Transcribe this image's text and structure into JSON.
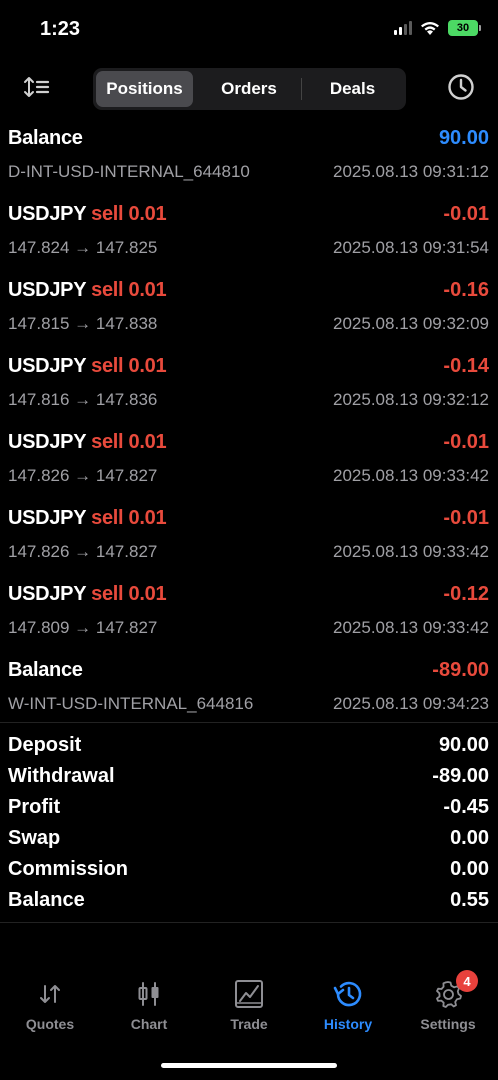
{
  "status": {
    "time": "1:23",
    "battery": "30"
  },
  "tabs": {
    "positions": "Positions",
    "orders": "Orders",
    "deals": "Deals"
  },
  "rows": [
    {
      "title": "Balance",
      "side": "",
      "amount": "90.00",
      "amount_type": "pos",
      "sub": "D-INT-USD-INTERNAL_644810",
      "time": "2025.08.13 09:31:12"
    },
    {
      "title": "USDJPY",
      "side": "sell 0.01",
      "amount": "-0.01",
      "amount_type": "neg",
      "sub": "147.824 → 147.825",
      "time": "2025.08.13 09:31:54"
    },
    {
      "title": "USDJPY",
      "side": "sell 0.01",
      "amount": "-0.16",
      "amount_type": "neg",
      "sub": "147.815 → 147.838",
      "time": "2025.08.13 09:32:09"
    },
    {
      "title": "USDJPY",
      "side": "sell 0.01",
      "amount": "-0.14",
      "amount_type": "neg",
      "sub": "147.816 → 147.836",
      "time": "2025.08.13 09:32:12"
    },
    {
      "title": "USDJPY",
      "side": "sell 0.01",
      "amount": "-0.01",
      "amount_type": "neg",
      "sub": "147.826 → 147.827",
      "time": "2025.08.13 09:33:42"
    },
    {
      "title": "USDJPY",
      "side": "sell 0.01",
      "amount": "-0.01",
      "amount_type": "neg",
      "sub": "147.826 → 147.827",
      "time": "2025.08.13 09:33:42"
    },
    {
      "title": "USDJPY",
      "side": "sell 0.01",
      "amount": "-0.12",
      "amount_type": "neg",
      "sub": "147.809 → 147.827",
      "time": "2025.08.13 09:33:42"
    },
    {
      "title": "Balance",
      "side": "",
      "amount": "-89.00",
      "amount_type": "neg",
      "sub": "W-INT-USD-INTERNAL_644816",
      "time": "2025.08.13 09:34:23"
    }
  ],
  "summary": [
    {
      "label": "Deposit",
      "value": "90.00"
    },
    {
      "label": "Withdrawal",
      "value": "-89.00"
    },
    {
      "label": "Profit",
      "value": "-0.45"
    },
    {
      "label": "Swap",
      "value": "0.00"
    },
    {
      "label": "Commission",
      "value": "0.00"
    },
    {
      "label": "Balance",
      "value": "0.55"
    }
  ],
  "tabbar": {
    "quotes": "Quotes",
    "chart": "Chart",
    "trade": "Trade",
    "history": "History",
    "settings": "Settings",
    "settings_badge": "4"
  },
  "colors": {
    "loss": "#e84a3c",
    "accent": "#2d8cff"
  }
}
